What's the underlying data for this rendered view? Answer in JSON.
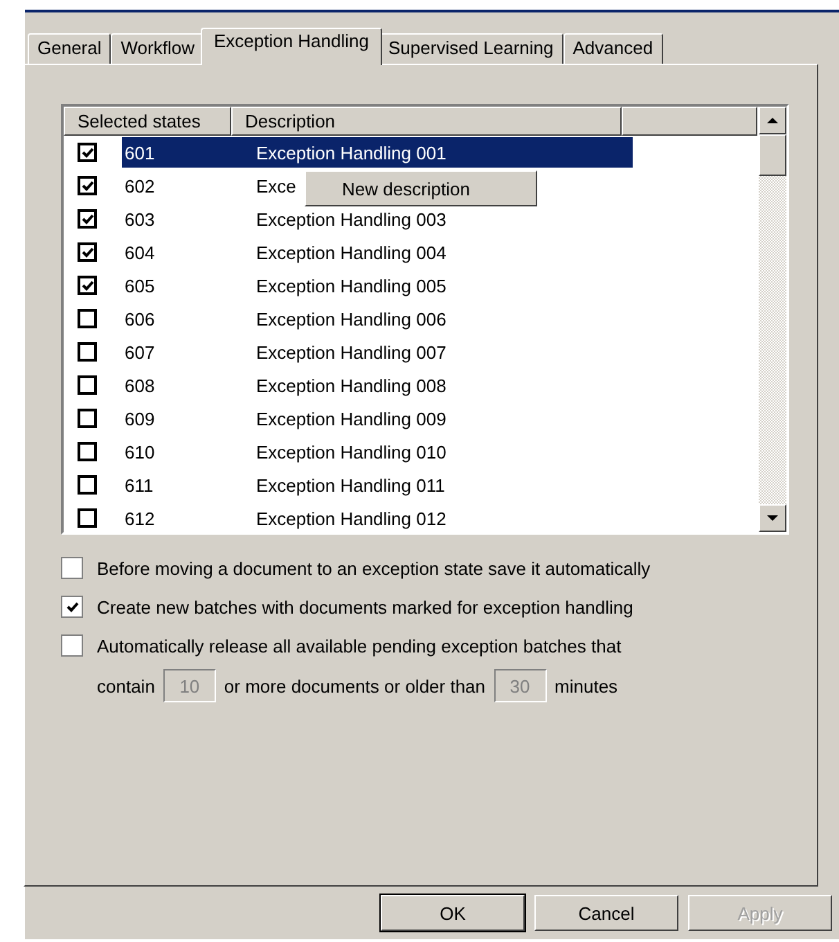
{
  "tabs": [
    {
      "label": "General",
      "selected": false
    },
    {
      "label": "Workflow",
      "selected": false
    },
    {
      "label": "Exception Handling",
      "selected": true
    },
    {
      "label": "Supervised Learning",
      "selected": false
    },
    {
      "label": "Advanced",
      "selected": false
    }
  ],
  "states_list": {
    "columns": [
      "Selected states",
      "Description"
    ],
    "rows": [
      {
        "state": "601",
        "description": "Exception Handling 001",
        "checked": true,
        "selected": true
      },
      {
        "state": "602",
        "description": "Exce",
        "checked": true,
        "selected": false
      },
      {
        "state": "603",
        "description": "Exception Handling 003",
        "checked": true,
        "selected": false
      },
      {
        "state": "604",
        "description": "Exception Handling 004",
        "checked": true,
        "selected": false
      },
      {
        "state": "605",
        "description": "Exception Handling 005",
        "checked": true,
        "selected": false
      },
      {
        "state": "606",
        "description": "Exception Handling 006",
        "checked": false,
        "selected": false
      },
      {
        "state": "607",
        "description": "Exception Handling 007",
        "checked": false,
        "selected": false
      },
      {
        "state": "608",
        "description": "Exception Handling 008",
        "checked": false,
        "selected": false
      },
      {
        "state": "609",
        "description": "Exception Handling 009",
        "checked": false,
        "selected": false
      },
      {
        "state": "610",
        "description": "Exception Handling 010",
        "checked": false,
        "selected": false
      },
      {
        "state": "611",
        "description": "Exception Handling 011",
        "checked": false,
        "selected": false
      },
      {
        "state": "612",
        "description": "Exception Handling 012",
        "checked": false,
        "selected": false
      }
    ],
    "context_menu": {
      "items": [
        "New description"
      ]
    }
  },
  "options": [
    {
      "label": "Before moving a document to an exception state save it automatically",
      "checked": false
    },
    {
      "label": "Create new batches with documents marked for exception handling",
      "checked": true
    },
    {
      "label": "Automatically release all available pending exception batches that",
      "checked": false
    }
  ],
  "release_condition": {
    "prefix": "contain",
    "count": {
      "value": "10",
      "disabled": true
    },
    "middle": "or more documents or older than",
    "minutes": {
      "value": "30",
      "disabled": true
    },
    "suffix": "minutes"
  },
  "buttons": [
    {
      "label": "OK",
      "default": true,
      "disabled": false
    },
    {
      "label": "Cancel",
      "default": false,
      "disabled": false
    },
    {
      "label": "Apply",
      "default": false,
      "disabled": true
    }
  ]
}
